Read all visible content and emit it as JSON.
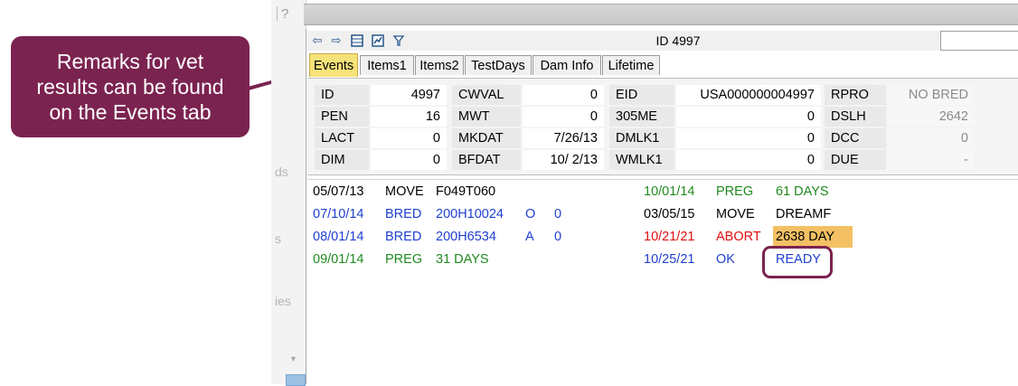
{
  "callout": {
    "text": "Remarks for vet\nresults can be found\non the Events tab"
  },
  "left_pane": {
    "help_icon": "?",
    "fragments": [
      "ds",
      "s",
      "ies"
    ]
  },
  "toolbar": {
    "icons": [
      "back-arrow-icon",
      "forward-arrow-icon",
      "table-icon",
      "chart-icon",
      "filter-icon"
    ],
    "title": "ID 4997"
  },
  "tabs": [
    {
      "label": "Events",
      "active": true
    },
    {
      "label": "Items1",
      "active": false
    },
    {
      "label": "Items2",
      "active": false
    },
    {
      "label": "TestDays",
      "active": false
    },
    {
      "label": "Dam Info",
      "active": false
    },
    {
      "label": "Lifetime",
      "active": false
    }
  ],
  "info": {
    "rows": [
      [
        [
          "ID",
          "4997"
        ],
        [
          "CWVAL",
          "0"
        ],
        [
          "EID",
          "USA000000004997"
        ],
        [
          "RPRO",
          "NO BRED"
        ]
      ],
      [
        [
          "PEN",
          "16"
        ],
        [
          "MWT",
          "0"
        ],
        [
          "305ME",
          "0"
        ],
        [
          "DSLH",
          "2642"
        ]
      ],
      [
        [
          "LACT",
          "0"
        ],
        [
          "MKDAT",
          "7/26/13"
        ],
        [
          "DMLK1",
          "0"
        ],
        [
          "DCC",
          "0"
        ]
      ],
      [
        [
          "DIM",
          "0"
        ],
        [
          "BFDAT",
          "10/ 2/13"
        ],
        [
          "WMLK1",
          "0"
        ],
        [
          "DUE",
          "-"
        ]
      ]
    ]
  },
  "events": {
    "left": [
      {
        "date": "05/07/13",
        "event": "MOVE",
        "remark": "F049T060",
        "t1": "",
        "t2": "",
        "color": "black"
      },
      {
        "date": "07/10/14",
        "event": "BRED",
        "remark": "200H10024",
        "t1": "O",
        "t2": "0",
        "color": "blue"
      },
      {
        "date": "08/01/14",
        "event": "BRED",
        "remark": "200H6534",
        "t1": "A",
        "t2": "0",
        "color": "blue"
      },
      {
        "date": "09/01/14",
        "event": "PREG",
        "remark": "31 DAYS",
        "t1": "",
        "t2": "",
        "color": "green"
      }
    ],
    "right": [
      {
        "date": "10/01/14",
        "event": "PREG",
        "remark": "61 DAYS",
        "color": "green"
      },
      {
        "date": "03/05/15",
        "event": "MOVE",
        "remark": "DREAMF",
        "color": "black"
      },
      {
        "date": "10/21/21",
        "event": "ABORT",
        "remark": "2638 DAY",
        "color": "red"
      },
      {
        "date": "10/25/21",
        "event": "OK",
        "remark": "READY",
        "color": "blue"
      }
    ]
  },
  "colors": {
    "callout": "#7b2350",
    "active_tab": "#f6e27a",
    "highlight": "#f3c064"
  }
}
